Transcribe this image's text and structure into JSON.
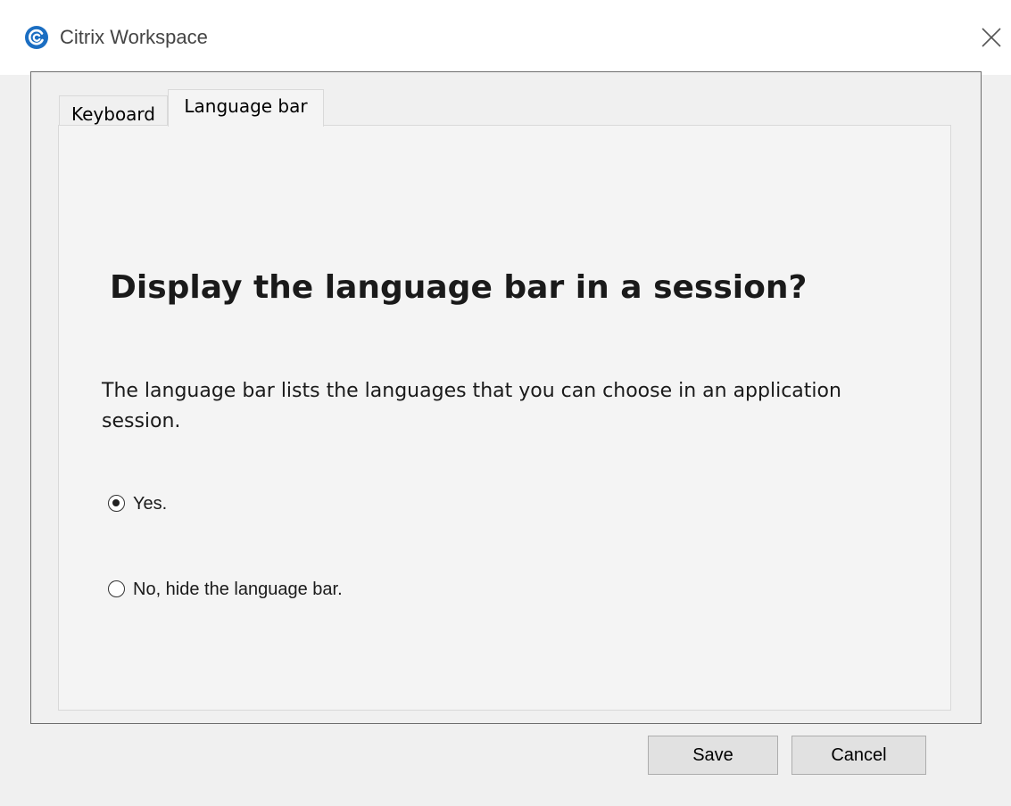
{
  "window": {
    "title": "Citrix Workspace",
    "accent": "#1b6ec2"
  },
  "tabs": [
    {
      "label": "Keyboard",
      "selected": false
    },
    {
      "label": "Language bar",
      "selected": true
    }
  ],
  "panel": {
    "heading": "Display the language bar in a session?",
    "description": "The language bar lists the languages that you can choose in an application session.",
    "options": [
      {
        "label": "Yes.",
        "selected": true
      },
      {
        "label": "No, hide the language bar.",
        "selected": false
      }
    ]
  },
  "buttons": {
    "save_label": "Save",
    "cancel_label": "Cancel"
  }
}
